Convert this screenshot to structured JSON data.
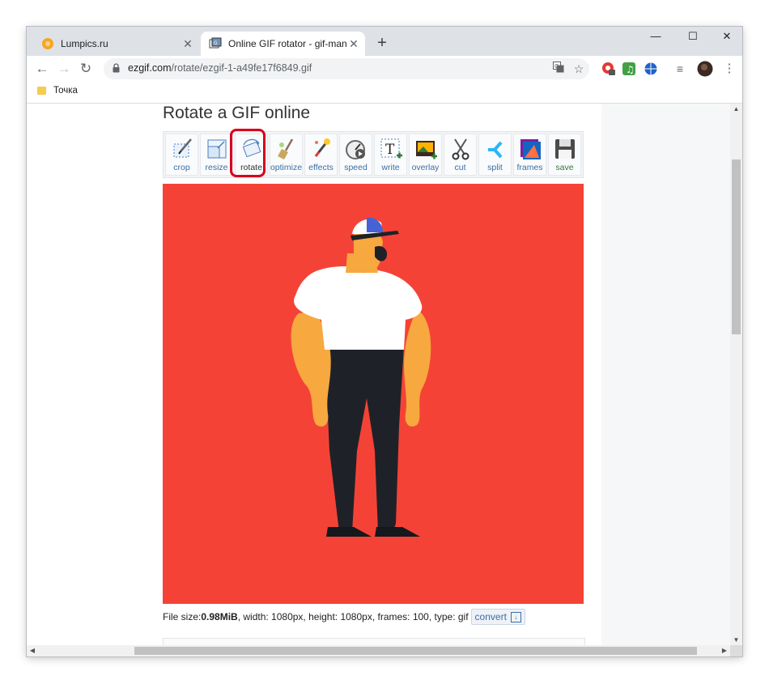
{
  "browser": {
    "tabs": [
      {
        "title": "Lumpics.ru",
        "favicon": "orange-circle-icon",
        "active": false
      },
      {
        "title": "Online GIF rotator - gif-man-mel",
        "favicon": "ezgif-icon",
        "active": true
      }
    ],
    "new_tab": "+",
    "window_controls": {
      "minimize": "—",
      "maximize": "☐",
      "close": "✕"
    },
    "address": {
      "host": "ezgif.com",
      "path": "/rotate/ezgif-1-a49fe17f6849.gif"
    },
    "bookmarks": [
      {
        "label": "Точка"
      }
    ]
  },
  "page": {
    "title": "Rotate a GIF online",
    "tools": [
      {
        "label": "crop",
        "icon": "crop-icon"
      },
      {
        "label": "resize",
        "icon": "resize-icon"
      },
      {
        "label": "rotate",
        "icon": "rotate-icon",
        "highlighted": true
      },
      {
        "label": "optimize",
        "icon": "optimize-broom-icon"
      },
      {
        "label": "effects",
        "icon": "effects-wand-icon"
      },
      {
        "label": "speed",
        "icon": "speed-dial-icon"
      },
      {
        "label": "write",
        "icon": "write-text-icon"
      },
      {
        "label": "overlay",
        "icon": "overlay-image-icon"
      },
      {
        "label": "cut",
        "icon": "scissors-icon"
      },
      {
        "label": "split",
        "icon": "split-icon"
      },
      {
        "label": "frames",
        "icon": "frames-icon"
      },
      {
        "label": "save",
        "icon": "floppy-disk-icon"
      }
    ],
    "file_info": {
      "size_label": "File size: ",
      "size_value": "0.98MiB",
      "details": ", width: 1080px, height: 1080px, frames: 100, type: gif",
      "convert_label": "convert"
    }
  },
  "colors": {
    "gif_background": "#f44336",
    "highlight": "#d6001c",
    "link": "#3a6ea5",
    "save_label": "#2e7d32"
  }
}
